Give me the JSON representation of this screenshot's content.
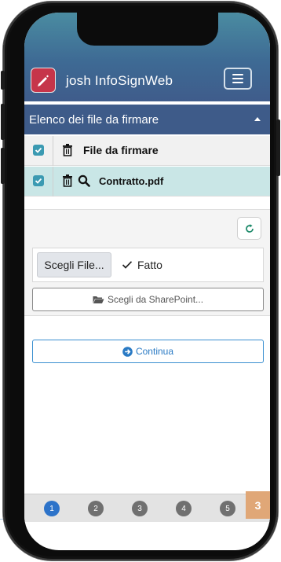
{
  "app": {
    "title": "josh InfoSignWeb",
    "logo_icon": "pen-signature-icon",
    "menu_icon": "hamburger-menu-icon"
  },
  "panel": {
    "title": "Elenco dei file da firmare",
    "rows": [
      {
        "label": "File da firmare",
        "checked": true
      },
      {
        "label": "Contratto.pdf",
        "checked": true
      }
    ]
  },
  "upload": {
    "choose_file_label": "Scegli File...",
    "status_label": "Fatto",
    "sharepoint_label": "Scegli da SharePoint..."
  },
  "actions": {
    "continue_label": "Continua"
  },
  "pager": {
    "pages": [
      "1",
      "2",
      "3",
      "4",
      "5"
    ],
    "current": "1"
  },
  "page_number": "3",
  "colors": {
    "header": "#3e5b89",
    "accent": "#2d73c9",
    "checkbox": "#3b9ab2",
    "selected_row": "#c9e6e6"
  }
}
